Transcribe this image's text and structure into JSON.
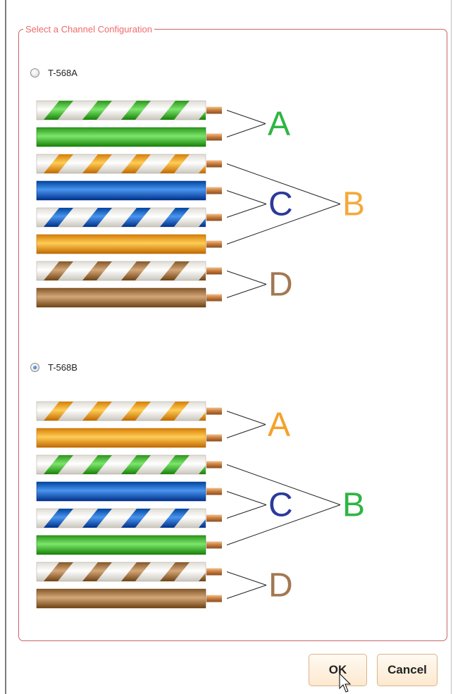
{
  "group": {
    "legend": "Select a Channel Configuration"
  },
  "configs": [
    {
      "id": "T568A",
      "label": "T-568A",
      "selected": false,
      "wires": [
        "green-stripe",
        "green",
        "orange-stripe",
        "blue",
        "blue-stripe",
        "orange",
        "brown-stripe",
        "brown"
      ],
      "pair_labels": [
        "A",
        "C",
        "B",
        "D"
      ],
      "pair_colors": [
        "#2fb544",
        "#2b3a9a",
        "#f5a93d",
        "#a27852"
      ]
    },
    {
      "id": "T568B",
      "label": "T-568B",
      "selected": true,
      "wires": [
        "orange-stripe",
        "orange",
        "green-stripe",
        "blue",
        "blue-stripe",
        "green",
        "brown-stripe",
        "brown"
      ],
      "pair_labels": [
        "A",
        "C",
        "B",
        "D"
      ],
      "pair_colors": [
        "#f5a12a",
        "#2b3a9a",
        "#2fb544",
        "#a27852"
      ]
    }
  ],
  "wire_colors": {
    "green": "#4fb83f",
    "orange": "#f8a029",
    "blue": "#1d68c2",
    "brown": "#a77a4c"
  },
  "buttons": {
    "ok": "OK",
    "cancel": "Cancel"
  }
}
